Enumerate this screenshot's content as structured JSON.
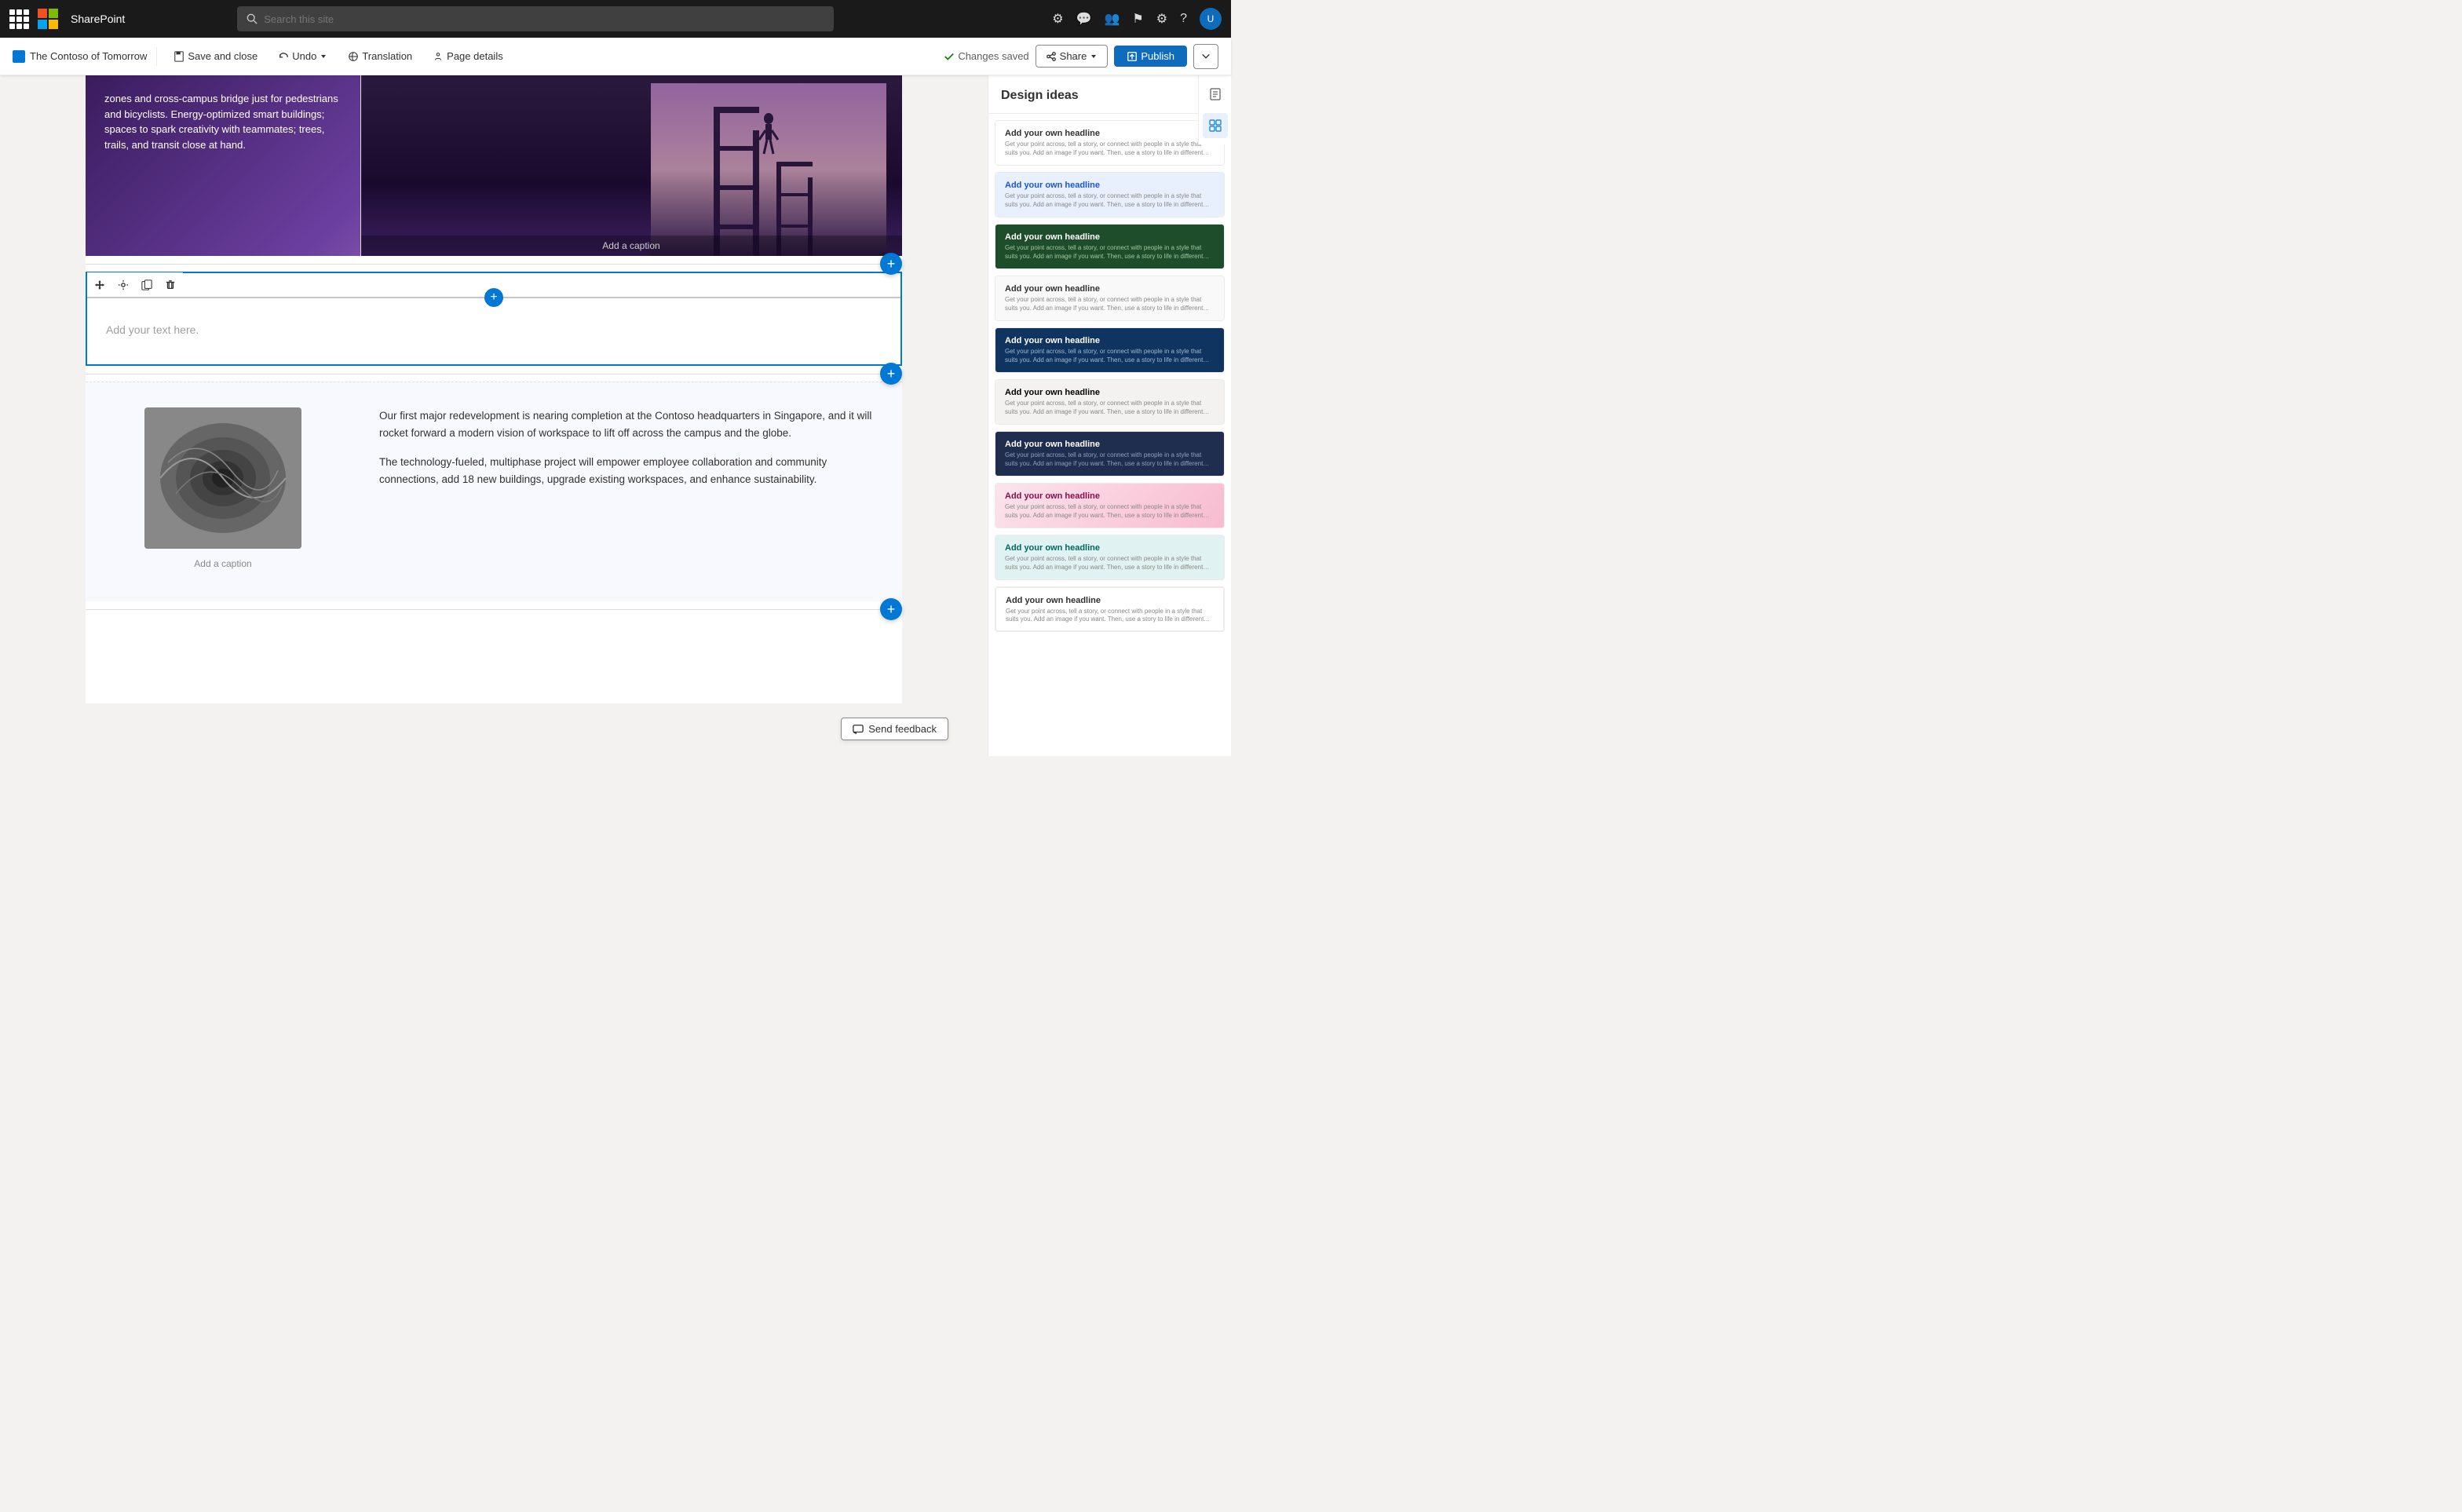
{
  "topbar": {
    "app_name": "SharePoint",
    "search_placeholder": "Search this site"
  },
  "toolbar": {
    "page_name": "The Contoso of Tomorrow",
    "save_label": "Save and close",
    "undo_label": "Undo",
    "translation_label": "Translation",
    "page_details_label": "Page details",
    "changes_saved_label": "Changes saved",
    "share_label": "Share",
    "publish_label": "Publish"
  },
  "design_panel": {
    "title": "Design ideas",
    "cards": [
      {
        "id": 1,
        "style": "white",
        "headline": "Add your own headline",
        "text": "Get your point across, tell a story, or connect with people in a style that suits you. Add an image if you want. Then, use a story to life in different layouts to help you make your page as beautiful and effective as possible."
      },
      {
        "id": 2,
        "style": "light-blue",
        "headline": "Add your own headline",
        "text": "Get your point across, tell a story, or connect with people in a style that suits you. Add an image if you want. Then, use a story to life in different layouts to help you make your page as beautiful and effective as possible."
      },
      {
        "id": 3,
        "style": "dark-green",
        "headline": "Add your own headline",
        "text": "Get your point across, tell a story, or connect with people in a style that suits you. Add an image if you want. Then, use a story to life in different layouts to help you make your page as beautiful and effective as possible."
      },
      {
        "id": 4,
        "style": "light-gray",
        "headline": "Add your own headline",
        "text": "Get your point across, tell a story, or connect with people in a style that suits you. Add an image if you want. Then, use a story to life in different layouts to help you make your page as beautiful and effective as possible."
      },
      {
        "id": 5,
        "style": "dark-blue",
        "headline": "Add your own headline",
        "text": "Get your point across, tell a story, or connect with people in a style that suits you. Add an image if you want. Then, use a story to life in different layouts to help you make your page as beautiful and effective as possible."
      },
      {
        "id": 6,
        "style": "medium-gray",
        "headline": "Add your own headline",
        "text": "Get your point across, tell a story, or connect with people in a style that suits you. Add an image if you want. Then, use a story to life in different layouts to help you make your page as beautiful and effective as possible."
      },
      {
        "id": 7,
        "style": "dark-navy",
        "headline": "Add your own headline",
        "text": "Get your point across, tell a story, or connect with people in a style that suits you. Add an image if you want. Then, use a story to life in different layouts to help you make your page as beautiful and effective as possible."
      },
      {
        "id": 8,
        "style": "pink-light",
        "headline": "Add your own headline",
        "text": "Get your point across, tell a story, or connect with people in a style that suits you. Add an image if you want. Then, use a story to life in different layouts to help you make your page as beautiful and effective as possible."
      },
      {
        "id": 9,
        "style": "teal-light",
        "headline": "Add your own headline",
        "text": "Get your point across, tell a story, or connect with people in a style that suits you. Add an image if you want. Then, use a story to life in different layouts to help you make your page as beautiful and effective as possible."
      },
      {
        "id": 10,
        "style": "white2",
        "headline": "Add your own headline",
        "text": "Get your point across, tell a story, or connect with people in a style that suits you. Add an image if you want. Then, use a story to life in different layouts to help you make your page as beautiful and effective as possible."
      }
    ]
  },
  "page": {
    "hero_text": "zones and cross-campus bridge just for pedestrians and bicyclists. Energy-optimized smart buildings; spaces to spark creativity with teammates; trees, trails, and transit close at hand.",
    "image_caption": "Add a caption",
    "text_placeholder": "Add your text here.",
    "col_caption": "Add a caption",
    "paragraph1": "Our first major redevelopment is nearing completion at the Contoso headquarters in Singapore, and it will rocket forward a modern vision of workspace to lift off across the campus and the globe.",
    "paragraph2": "The technology-fueled, multiphase project will empower employee collaboration and community connections, add 18 new buildings, upgrade existing workspaces, and enhance sustainability."
  },
  "feedback": {
    "label": "Send feedback"
  }
}
